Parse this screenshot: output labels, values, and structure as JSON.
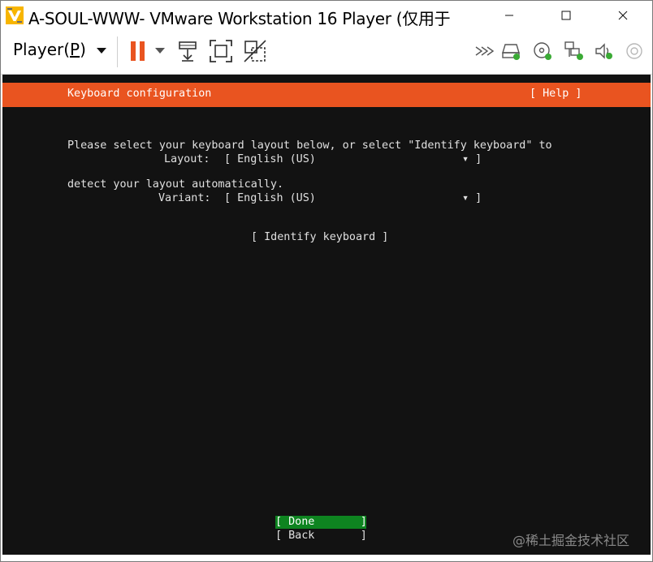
{
  "window": {
    "title": "A-SOUL-WWW- VMware Workstation 16 Player (仅用于",
    "minimize_icon": "minimize-icon",
    "maximize_icon": "maximize-icon",
    "close_icon": "close-icon"
  },
  "toolbar": {
    "player_menu_label": "Player(",
    "player_menu_accel": "P",
    "player_menu_end": ")",
    "icons": [
      "pause-icon",
      "send-ctrl-alt-del-icon",
      "fullscreen-icon",
      "unity-icon",
      "more-devices-icon",
      "hard-disk-icon",
      "cd-dvd-icon",
      "network-icon",
      "sound-icon",
      "usb-icon"
    ],
    "accent_color": "#e95420",
    "device_active_color": "#3aaa35"
  },
  "installer": {
    "header_title": "Keyboard configuration",
    "help_label": "[ Help ]",
    "description_line1": "Please select your keyboard layout below, or select \"Identify keyboard\" to",
    "description_line2": "detect your layout automatically.",
    "layout_label": "Layout:",
    "layout_value": "[ English (US)",
    "layout_arrow": "▾ ]",
    "variant_label": "Variant:",
    "variant_value": "[ English (US)",
    "variant_arrow": "▾ ]",
    "identify_button": "[ Identify keyboard ]",
    "done_button": "[ Done       ]",
    "back_button": "[ Back       ]",
    "header_color": "#e95420",
    "done_color": "#0e8420",
    "background_color": "#121212"
  },
  "watermark": "@稀土掘金技术社区"
}
